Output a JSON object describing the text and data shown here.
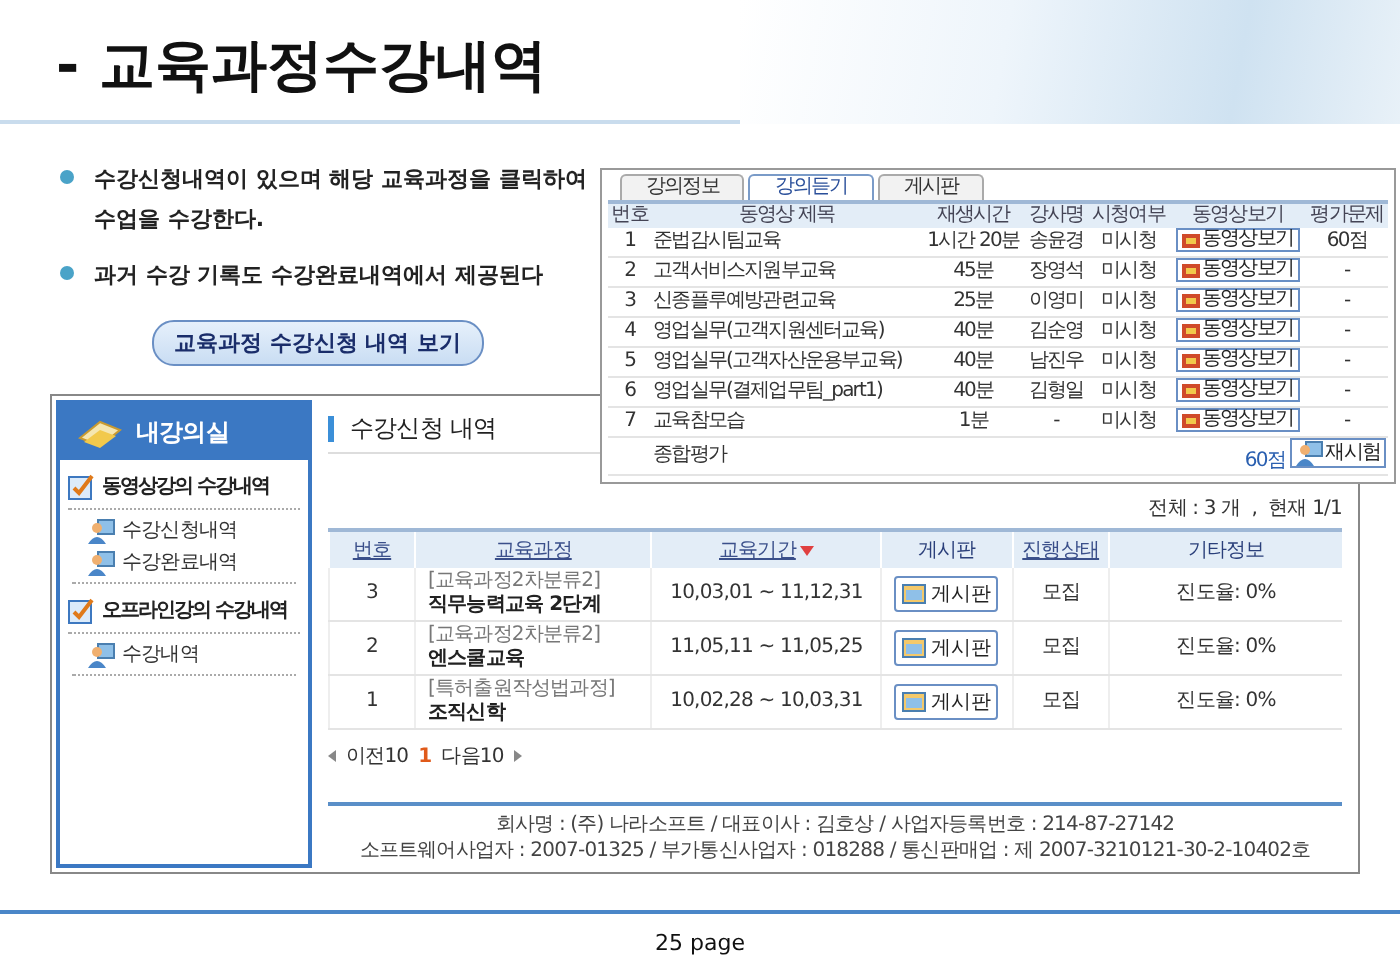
{
  "title": "- 교육과정수강내역",
  "bullets": [
    "수강신청내역이 있으며 해당 교육과정을 클릭하여 수업을 수강한다.",
    "과거 수강 기록도 수강완료내역에서 제공된다"
  ],
  "view_button": "교육과정 수강신청 내역 보기",
  "inset": {
    "tabs": [
      {
        "label": "강의정보",
        "selected": false
      },
      {
        "label": "강의듣기",
        "selected": true
      },
      {
        "label": "게시판",
        "selected": false
      }
    ],
    "columns": [
      "번호",
      "동영상 제목",
      "재생시간",
      "강사명",
      "시청여부",
      "동영상보기",
      "평가문제"
    ],
    "rows": [
      {
        "no": "1",
        "title": "준법감시팀교육",
        "duration": "1시간 20분",
        "instructor": "송윤경",
        "status": "미시청",
        "button": "동영상보기",
        "score": "60점"
      },
      {
        "no": "2",
        "title": "고객서비스지원부교육",
        "duration": "45분",
        "instructor": "장영석",
        "status": "미시청",
        "button": "동영상보기",
        "score": "-"
      },
      {
        "no": "3",
        "title": "신종플루예방관련교육",
        "duration": "25분",
        "instructor": "이영미",
        "status": "미시청",
        "button": "동영상보기",
        "score": "-"
      },
      {
        "no": "4",
        "title": "영업실무(고객지원센터교육)",
        "duration": "40분",
        "instructor": "김순영",
        "status": "미시청",
        "button": "동영상보기",
        "score": "-"
      },
      {
        "no": "5",
        "title": "영업실무(고객자산운용부교육)",
        "duration": "40분",
        "instructor": "남진우",
        "status": "미시청",
        "button": "동영상보기",
        "score": "-"
      },
      {
        "no": "6",
        "title": "영업실무(결제업무팀_part1)",
        "duration": "40분",
        "instructor": "김형일",
        "status": "미시청",
        "button": "동영상보기",
        "score": "-"
      },
      {
        "no": "7",
        "title": "교육참모습",
        "duration": "1분",
        "instructor": "-",
        "status": "미시청",
        "button": "동영상보기",
        "score": "-"
      }
    ],
    "summary": {
      "title": "종합평가",
      "score": "60점",
      "button": "재시험"
    }
  },
  "sidebar": {
    "title": "내강의실",
    "sections": [
      {
        "label": "동영상강의 수강내역",
        "items": [
          "수강신청내역",
          "수강완료내역"
        ]
      },
      {
        "label": "오프라인강의 수강내역",
        "items": [
          "수강내역"
        ]
      }
    ]
  },
  "heading": "수강신청 내역",
  "total": "전체 : 3 개  ,  현재 1/1",
  "columns": [
    {
      "label": "번호",
      "link": true,
      "sorted": false
    },
    {
      "label": "교육과정",
      "link": true,
      "sorted": false
    },
    {
      "label": "교육기간",
      "link": true,
      "sorted": true
    },
    {
      "label": "게시판",
      "link": false,
      "sorted": false
    },
    {
      "label": "진행상태",
      "link": true,
      "sorted": false
    },
    {
      "label": "기타정보",
      "link": false,
      "sorted": false
    }
  ],
  "rows": [
    {
      "no": "3",
      "category": "[교육과정2차분류2]",
      "course": "직무능력교육 2단계",
      "period": "10,03,01 ~ 11,12,31",
      "board": "게시판",
      "status": "모집",
      "info": "진도율: 0%"
    },
    {
      "no": "2",
      "category": "[교육과정2차분류2]",
      "course": "엔스쿨교육",
      "period": "11,05,11 ~ 11,05,25",
      "board": "게시판",
      "status": "모집",
      "info": "진도율: 0%"
    },
    {
      "no": "1",
      "category": "[특허출원작성법과정]",
      "course": "조직신학",
      "period": "10,02,28 ~ 10,03,31",
      "board": "게시판",
      "status": "모집",
      "info": "진도율: 0%"
    }
  ],
  "pagination": {
    "prev": "이전10",
    "pages": [
      {
        "label": "1",
        "selected": true
      }
    ],
    "next": "다음10"
  },
  "footer": [
    "회사명 : (주) 나라소프트 / 대표이사 : 김호상 / 사업자등록번호 : 214-87-27142",
    "소프트웨어사업자 : 2007-01325 / 부가통신사업자 : 018288 / 통신판매업 : 제 2007-3210121-30-2-10402호"
  ],
  "page_number": "25 page"
}
